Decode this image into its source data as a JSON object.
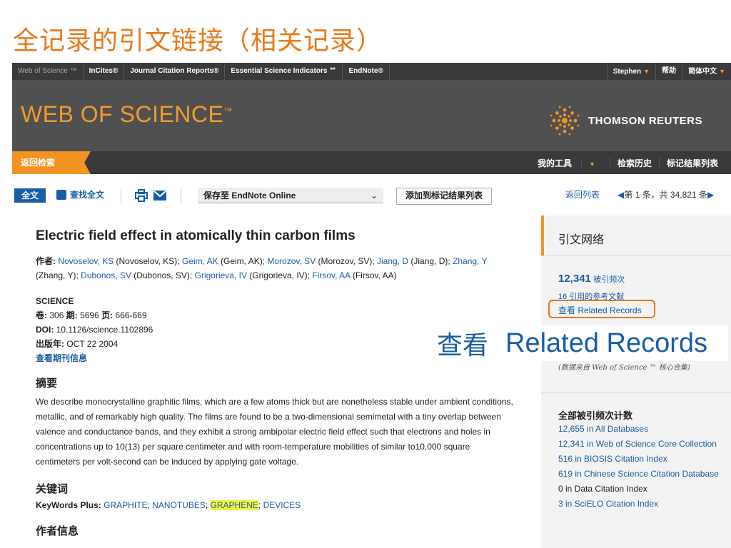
{
  "slide_title": "全记录的引文链接（相关记录）",
  "topnav": {
    "items": [
      "Web of Science ™",
      "InCites®",
      "Journal Citation Reports®",
      "Essential Science Indicators ℠",
      "EndNote®"
    ],
    "user": "Stephen",
    "help": "帮助",
    "language": "简体中文"
  },
  "hero": {
    "logo": "WEB OF SCIENCE",
    "tm": "™",
    "brand": "THOMSON REUTERS"
  },
  "subbar": {
    "back": "返回检索",
    "tools": [
      "我的工具",
      "检索历史",
      "标记结果列表"
    ]
  },
  "toolbar": {
    "fulltext": "全文",
    "find_fulltext": "查找全文",
    "save_select": "保存至 EndNote Online",
    "add_marked": "添加到标记结果列表",
    "back_list": "返回列表",
    "pager": "第 1 条，共 34,821 条"
  },
  "record": {
    "title": "Electric field effect in atomically thin carbon films",
    "authors_label": "作者:",
    "authors": [
      {
        "link": "Novoselov, KS",
        "full": "(Novoselov, KS);"
      },
      {
        "link": "Geim, AK",
        "full": "(Geim, AK);"
      },
      {
        "link": "Morozov, SV",
        "full": "(Morozov, SV);"
      },
      {
        "link": "Jiang, D",
        "full": "(Jiang, D);"
      },
      {
        "link": "Zhang, Y",
        "full": "(Zhang, Y);"
      },
      {
        "link": "Dubonos, SV",
        "full": "(Dubonos, SV);"
      },
      {
        "link": "Grigorieva, IV",
        "full": "(Grigorieva, IV);"
      },
      {
        "link": "Firsov, AA",
        "full": "(Firsov, AA)"
      }
    ],
    "journal": "SCIENCE",
    "volume_label": "卷:",
    "volume": "306",
    "issue_label": "期:",
    "issue": "5696",
    "pages_label": "页:",
    "pages": "666-669",
    "doi_label": "DOI:",
    "doi": "10.1126/science.1102896",
    "pubdate_label": "出版年:",
    "pubdate": "OCT 22 2004",
    "journal_info": "查看期刊信息",
    "abstract_h": "摘要",
    "abstract": "We describe monocrystalline graphitic films, which are a few atoms thick but are nonetheless stable under ambient conditions, metallic, and of remarkably high quality. The films are found to be a two-dimensional semimetal with a tiny overlap between valence and conductance bands, and they exhibit a strong ambipolar electric field effect such that electrons and holes in concentrations up to 10(13) per square centimeter and with room-temperature mobilities of similar to10,000 square centimeters per volt-second can be induced by applying gate voltage.",
    "keywords_h": "关键词",
    "kw_label": "KeyWords Plus:",
    "keywords": [
      "GRAPHITE",
      "NANOTUBES",
      "GRAPHENE",
      "DEVICES"
    ],
    "author_info_h": "作者信息"
  },
  "sidebar": {
    "heading": "引文网络",
    "times_cited": "12,341",
    "times_cited_label": "被引频次",
    "cited_refs": "16 引用的参考文献",
    "related": "查看 Related Records",
    "note": "(数据来自 Web of Science ™ 核心合集)",
    "all_cites_h": "全部被引频次计数",
    "all_cites": [
      "12,655 in All Databases",
      "12,341 in Web of Science Core Collection",
      "516 in BIOSIS Citation Index",
      "619 in Chinese Science Citation Database",
      "0 in Data Citation Index",
      "3 in SciELO Citation Index"
    ]
  },
  "callout": {
    "zh": "查看",
    "en": "Related Records"
  },
  "colors": {
    "accent": "#f39322",
    "link": "#1a5da6",
    "highlight": "#f6f63a"
  }
}
